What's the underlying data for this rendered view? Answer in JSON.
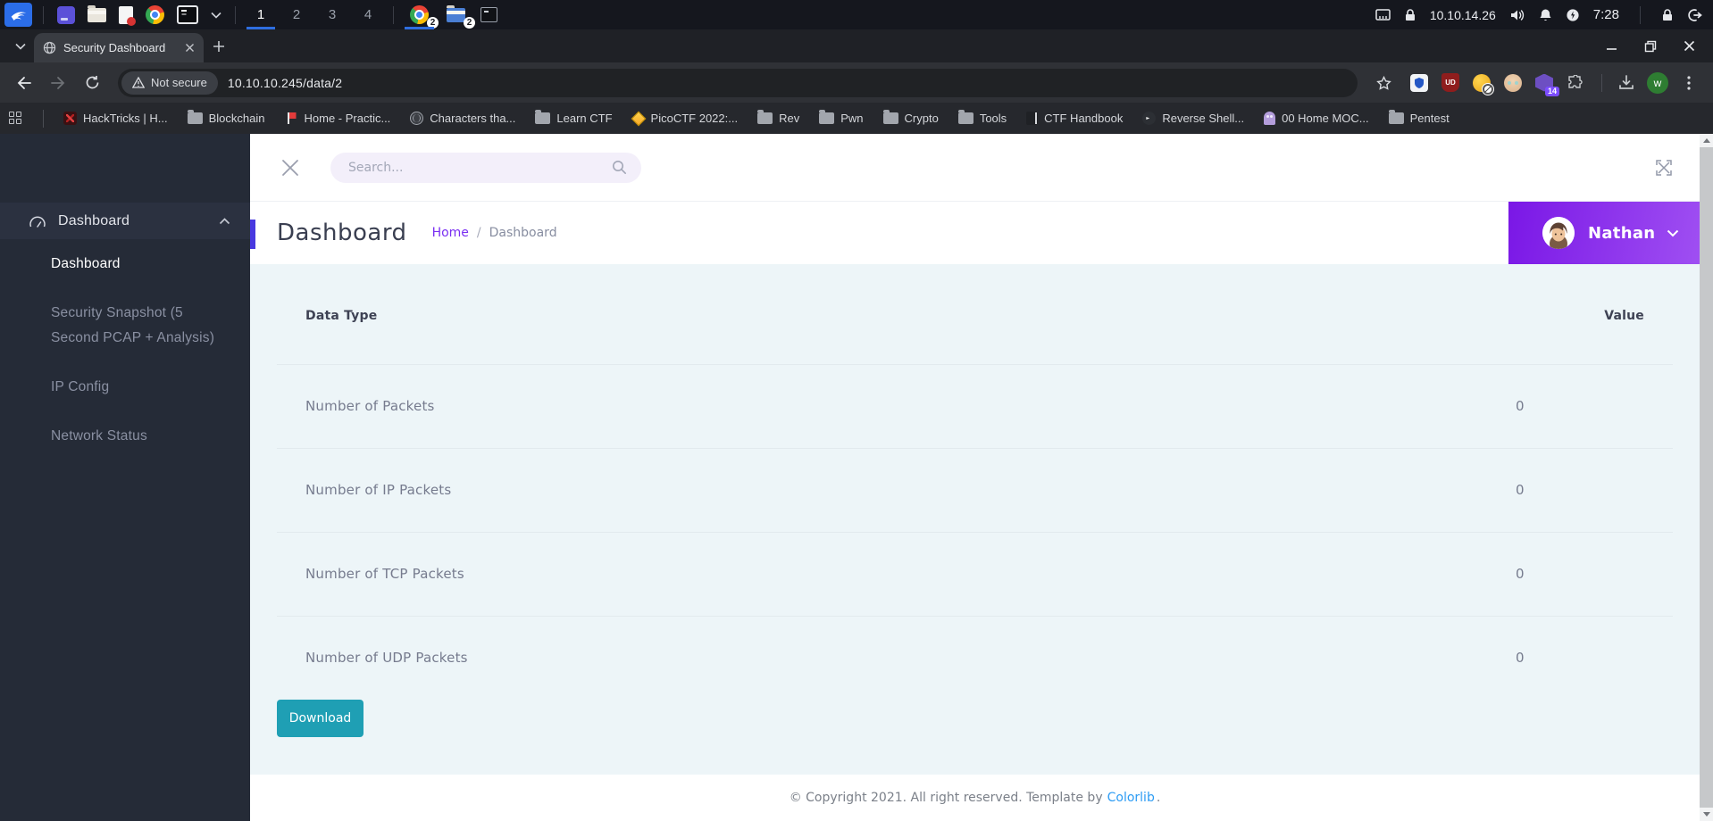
{
  "taskbar": {
    "workspaces": [
      {
        "label": "1",
        "active": true
      },
      {
        "label": "2",
        "active": false
      },
      {
        "label": "3",
        "active": false
      },
      {
        "label": "4",
        "active": false
      }
    ],
    "chrome_window_badge": "2",
    "files_window_badge": "2",
    "tray": {
      "vpn_ip": "10.10.14.26",
      "time": "7:28"
    }
  },
  "browser": {
    "tab_title": "Security Dashboard",
    "security_chip": "Not secure",
    "url": "10.10.10.245/data/2",
    "extension_shield_label": "UD",
    "extension_badge_count": "14",
    "profile_initial": "w",
    "bookmarks": [
      {
        "label": "HackTricks | H..."
      },
      {
        "label": "Blockchain"
      },
      {
        "label": "Home - Practic..."
      },
      {
        "label": "Characters tha..."
      },
      {
        "label": "Learn CTF"
      },
      {
        "label": "PicoCTF 2022:..."
      },
      {
        "label": "Rev"
      },
      {
        "label": "Pwn"
      },
      {
        "label": "Crypto"
      },
      {
        "label": "Tools"
      },
      {
        "label": "CTF Handbook"
      },
      {
        "label": "Reverse Shell..."
      },
      {
        "label": "00 Home MOC..."
      },
      {
        "label": "Pentest"
      }
    ]
  },
  "app": {
    "search_placeholder": "Search...",
    "sidebar": {
      "parent_label": "Dashboard",
      "items": [
        {
          "label": "Dashboard",
          "active": true
        },
        {
          "label": "Security Snapshot (5 Second PCAP + Analysis)",
          "active": false
        },
        {
          "label": "IP Config",
          "active": false
        },
        {
          "label": "Network Status",
          "active": false
        }
      ]
    },
    "header": {
      "title": "Dashboard",
      "breadcrumb_home": "Home",
      "breadcrumb_sep": "/",
      "breadcrumb_current": "Dashboard",
      "user_name": "Nathan"
    },
    "table": {
      "col_type": "Data Type",
      "col_value": "Value",
      "rows": [
        {
          "label": "Number of Packets",
          "value": "0"
        },
        {
          "label": "Number of IP Packets",
          "value": "0"
        },
        {
          "label": "Number of TCP Packets",
          "value": "0"
        },
        {
          "label": "Number of UDP Packets",
          "value": "0"
        }
      ]
    },
    "download_label": "Download",
    "footer": {
      "text": "© Copyright 2021. All right reserved. Template by",
      "link": "Colorlib",
      "suffix": "."
    }
  },
  "colors": {
    "title_accent": "#4839e0",
    "user_badge_gradient": [
      "#7a17e6",
      "#9f4ff2"
    ],
    "breadcrumb_link": "#7a2ff2",
    "download_button": "#1f9fb4",
    "footer_link": "#2d9cf4",
    "content_background": "#edf5f8",
    "sidebar_background": "#252b37",
    "taskbar_indicator": "#2e6ee0"
  }
}
